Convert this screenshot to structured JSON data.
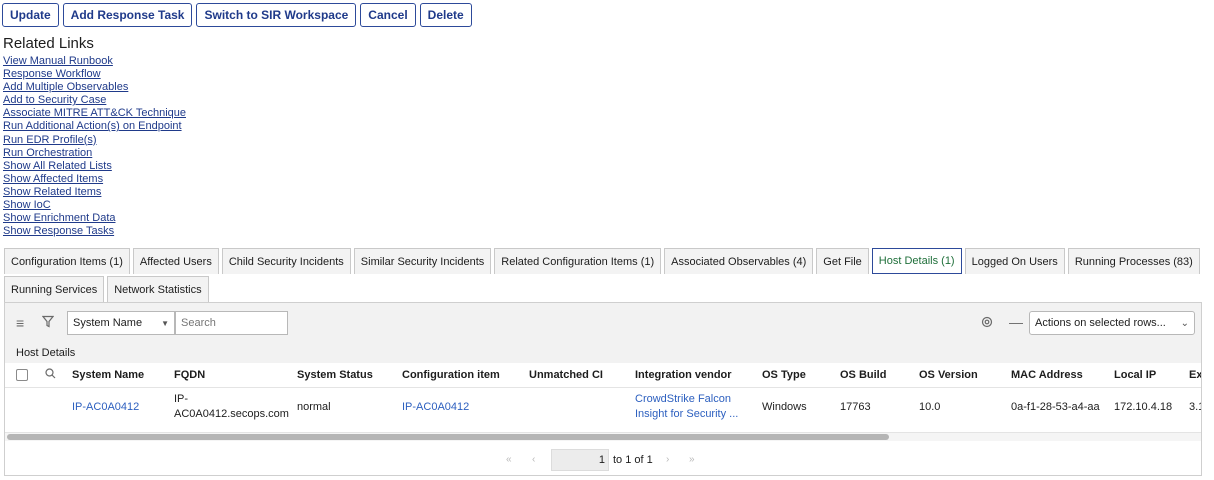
{
  "toolbar": {
    "buttons": [
      "Update",
      "Add Response Task",
      "Switch to SIR Workspace",
      "Cancel",
      "Delete"
    ]
  },
  "related_links": {
    "title": "Related Links",
    "items": [
      "View Manual Runbook",
      "Response Workflow",
      "Add Multiple Observables",
      "Add to Security Case",
      "Associate MITRE ATT&CK Technique",
      "Run Additional Action(s) on Endpoint",
      "Run EDR Profile(s)",
      "Run Orchestration",
      "Show All Related Lists",
      "Show Affected Items",
      "Show Related Items",
      "Show IoC",
      "Show Enrichment Data",
      "Show Response Tasks"
    ]
  },
  "tabs": {
    "row1": [
      "Configuration Items (1)",
      "Affected Users",
      "Child Security Incidents",
      "Similar Security Incidents",
      "Related Configuration Items (1)",
      "Associated Observables (4)",
      "Get File",
      "Host Details (1)",
      "Logged On Users",
      "Running Processes (83)"
    ],
    "row2": [
      "Running Services",
      "Network Statistics"
    ],
    "active": "Host Details (1)"
  },
  "list": {
    "field_select": "System Name",
    "search_placeholder": "Search",
    "actions_select": "Actions on selected rows...",
    "section_title": "Host Details",
    "columns": [
      "System Name",
      "FQDN",
      "System Status",
      "Configuration item",
      "Unmatched CI",
      "Integration vendor",
      "OS Type",
      "OS Build",
      "OS Version",
      "MAC Address",
      "Local IP",
      "Ex"
    ],
    "row": {
      "system_name": "IP-AC0A0412",
      "fqdn_line1": "IP-",
      "fqdn_line2": "AC0A0412.secops.com",
      "system_status": "normal",
      "configuration_item": "IP-AC0A0412",
      "unmatched_ci": "",
      "vendor_line1": "CrowdStrike Falcon",
      "vendor_line2": "Insight for Security ...",
      "os_type": "Windows",
      "os_build": "17763",
      "os_version": "10.0",
      "mac_address": "0a-f1-28-53-a4-aa",
      "local_ip": "172.10.4.18",
      "ex": "3.1"
    },
    "pager": {
      "current": "1",
      "range_text": "to 1 of 1"
    }
  },
  "colors": {
    "button_border": "#2d4a9a",
    "link": "#1f3a8a",
    "table_link": "#2c5fbf",
    "active_tab_text": "#1f6f3a"
  }
}
